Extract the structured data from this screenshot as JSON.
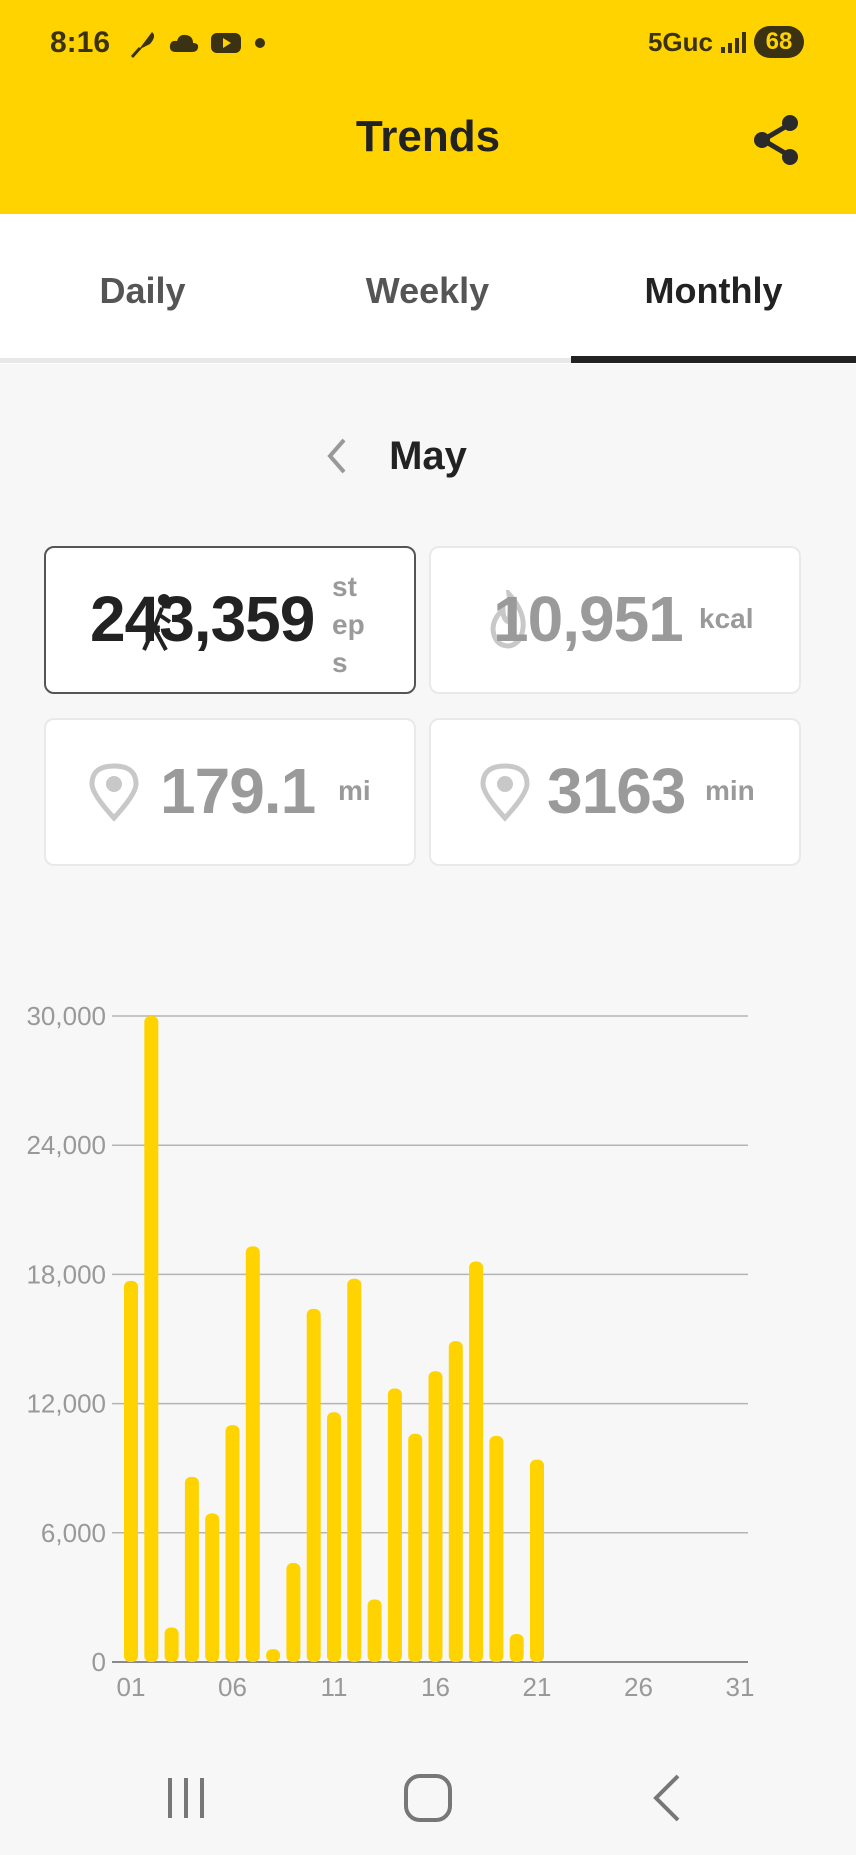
{
  "status_bar": {
    "time": "8:16",
    "network": "5Guc",
    "battery": "68",
    "left_icons": [
      "feather-icon",
      "cloud-icon",
      "youtube-icon",
      "dot-icon"
    ]
  },
  "header": {
    "title": "Trends",
    "share_icon": "share-icon",
    "background": "#ffd300"
  },
  "tabs": [
    {
      "label": "Daily",
      "active": false
    },
    {
      "label": "Weekly",
      "active": false
    },
    {
      "label": "Monthly",
      "active": true
    }
  ],
  "period": {
    "label": "May",
    "prev_icon": "chevron-left-icon"
  },
  "stats": {
    "steps": {
      "value": "243,359",
      "unit_lines": [
        "st",
        "ep",
        "s"
      ],
      "icon": "walking-icon",
      "selected": true
    },
    "calories": {
      "value": "10,951",
      "unit": "kcal",
      "icon": "flame-icon"
    },
    "distance": {
      "value": "179.1",
      "unit": "mi",
      "icon": "location-pin-icon"
    },
    "duration": {
      "value": "3163",
      "unit": "min",
      "icon": "location-pin-icon"
    }
  },
  "chart_data": {
    "type": "bar",
    "x": [
      1,
      2,
      3,
      4,
      5,
      6,
      7,
      8,
      9,
      10,
      11,
      12,
      13,
      14,
      15,
      16,
      17,
      18,
      19,
      20,
      21
    ],
    "values": [
      17700,
      30000,
      1600,
      8600,
      6900,
      11000,
      19300,
      600,
      4600,
      16400,
      11600,
      17800,
      2900,
      12700,
      10600,
      13500,
      14900,
      18600,
      10500,
      1300,
      9400
    ],
    "x_ticks": [
      "01",
      "06",
      "11",
      "16",
      "21",
      "26",
      "31"
    ],
    "y_ticks": [
      "0",
      "6,000",
      "12,000",
      "18,000",
      "24,000",
      "30,000"
    ],
    "ylim": [
      0,
      30000
    ],
    "xlim": [
      1,
      31
    ],
    "grid": true,
    "bar_color": "#ffd300"
  },
  "nav_bar": {
    "icons": [
      "recent-apps-icon",
      "home-icon",
      "back-icon"
    ]
  }
}
